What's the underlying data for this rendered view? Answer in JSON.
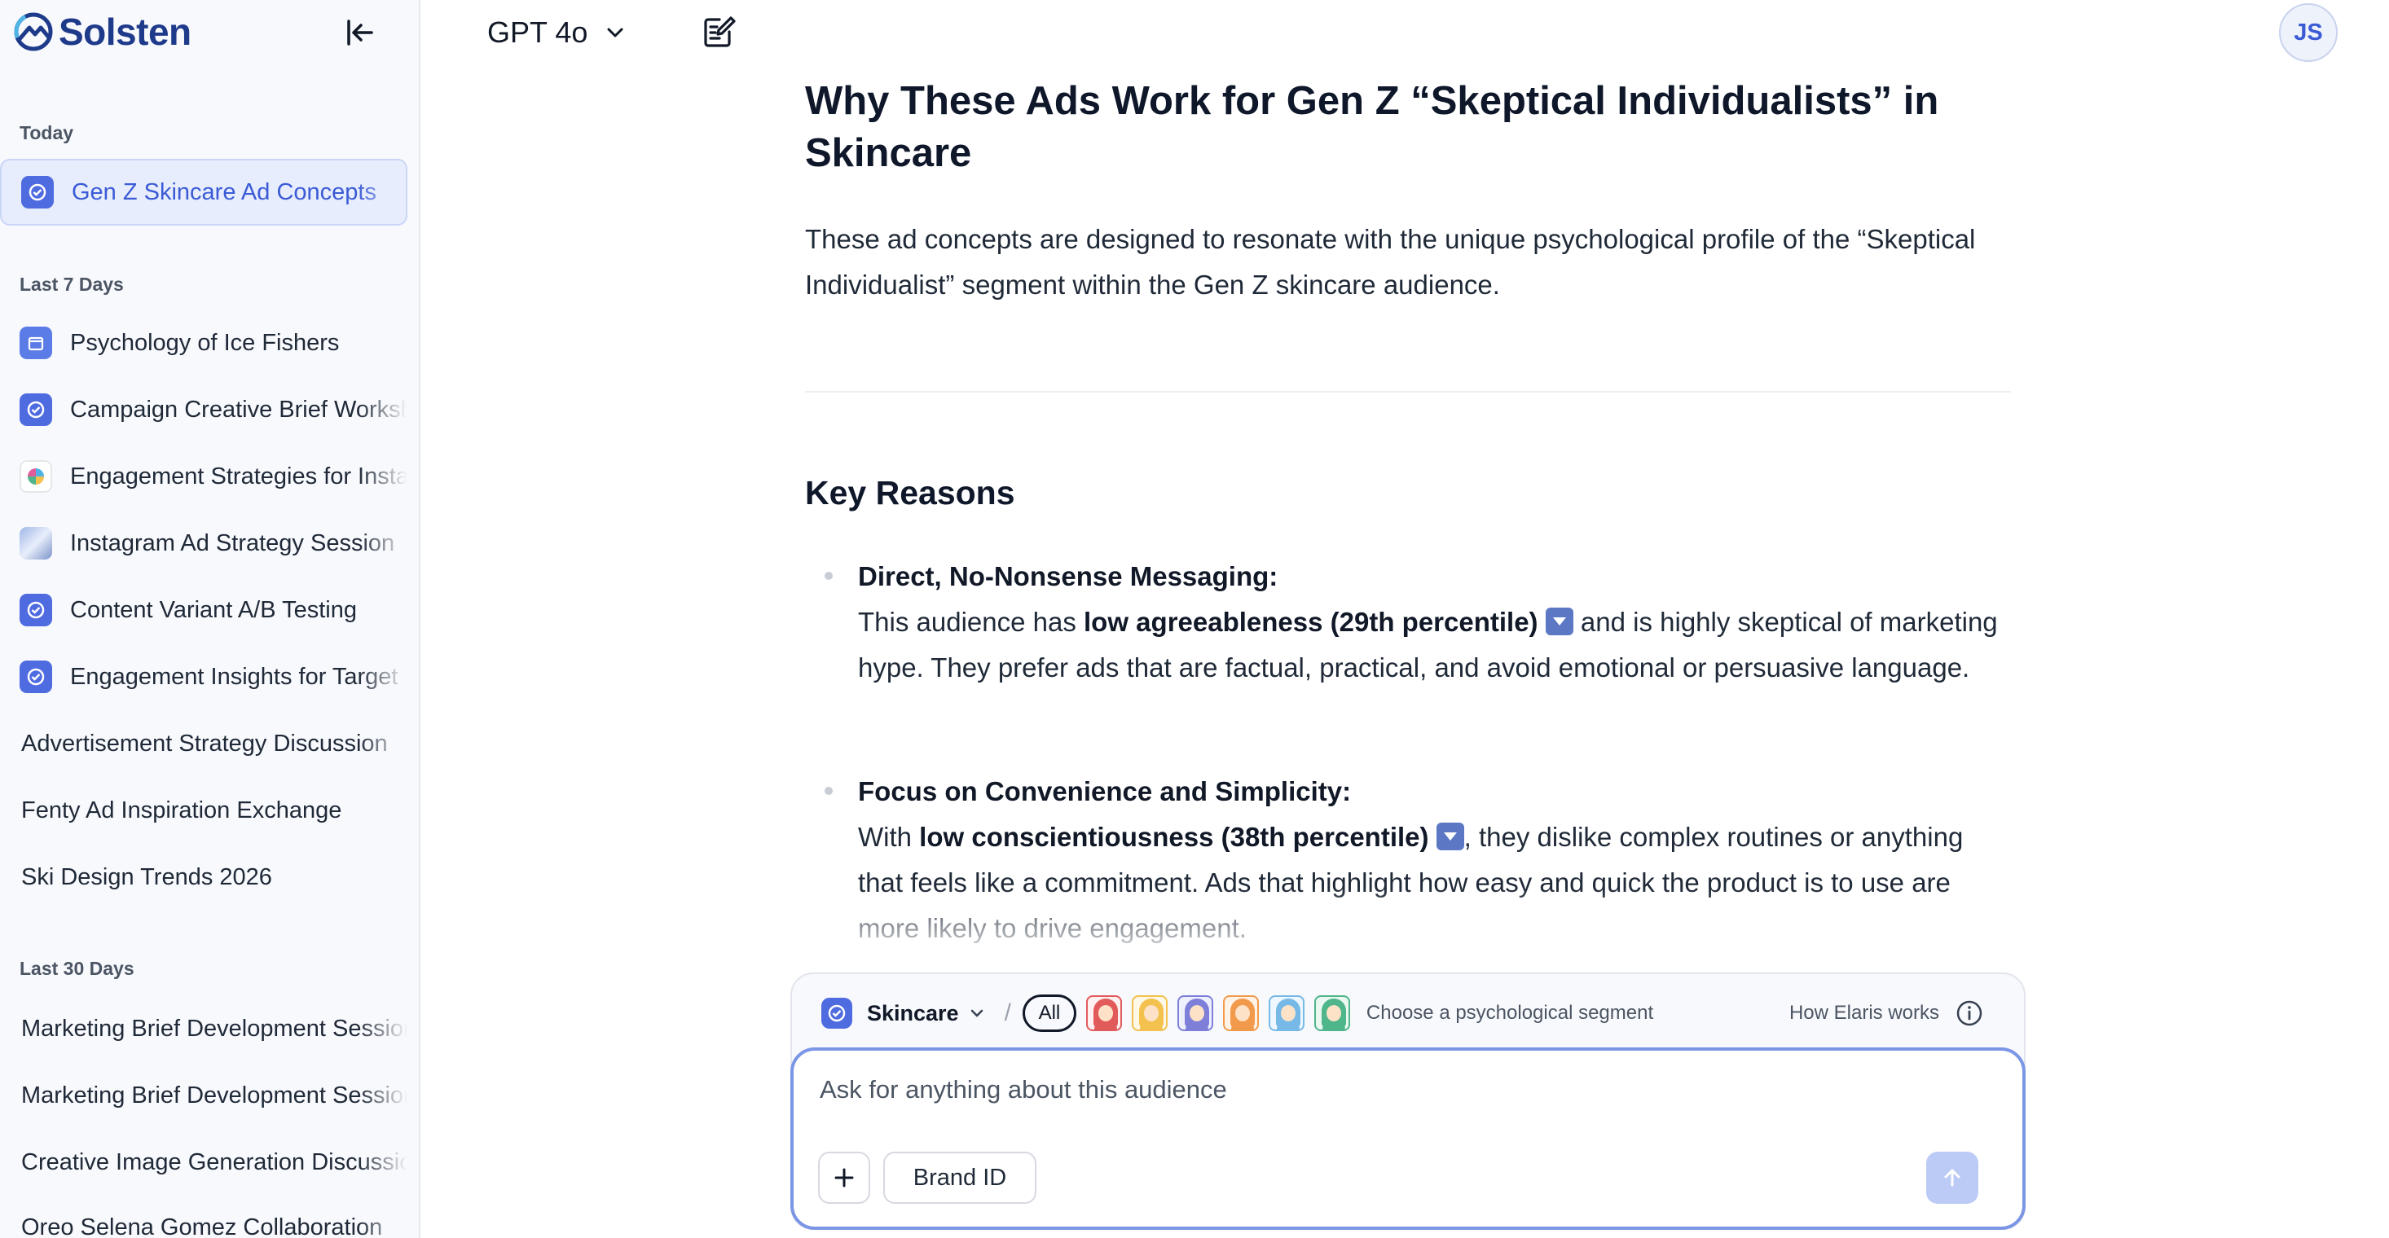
{
  "brand": {
    "name": "Solsten"
  },
  "sidebar": {
    "sections": {
      "today": "Today",
      "last7": "Last 7 Days",
      "last30": "Last 30 Days"
    },
    "today_items": [
      {
        "label": "Gen Z Skincare Ad Concepts",
        "icon": "badge-check-icon"
      }
    ],
    "last7_items": [
      {
        "label": "Psychology of Ice Fishers",
        "icon": "calendar-icon"
      },
      {
        "label": "Campaign Creative Brief Workshop",
        "icon": "badge-check-icon"
      },
      {
        "label": "Engagement Strategies for Instagram",
        "icon": "pinwheel-icon"
      },
      {
        "label": "Instagram Ad Strategy Session",
        "icon": "photo-thumbnail-icon"
      },
      {
        "label": "Content Variant A/B Testing",
        "icon": "badge-check-icon"
      },
      {
        "label": "Engagement Insights for Target",
        "icon": "badge-check-icon"
      },
      {
        "label": "Advertisement Strategy Discussion",
        "icon": ""
      },
      {
        "label": "Fenty Ad Inspiration Exchange",
        "icon": ""
      },
      {
        "label": "Ski Design Trends 2026",
        "icon": ""
      }
    ],
    "last30_items": [
      {
        "label": "Marketing Brief Development Session"
      },
      {
        "label": "Marketing Brief Development Session"
      },
      {
        "label": "Creative Image Generation Discussion"
      },
      {
        "label": "Oreo Selena Gomez Collaboration"
      }
    ]
  },
  "topbar": {
    "model": "GPT 4o",
    "avatar_initials": "JS"
  },
  "article": {
    "title": "Why These Ads Work for Gen Z “Skeptical Individualists” in Skincare",
    "intro": "These ad concepts are designed to resonate with the unique psychological profile of the “Skeptical Individualist” segment within the Gen Z skincare audience.",
    "section_heading": "Key Reasons",
    "reasons": [
      {
        "title": "Direct, No-Nonsense Messaging:",
        "lead": "This audience has ",
        "bold": "low agreeableness (29th percentile)",
        "rest": " and is highly skeptical of marketing hype. They prefer ads that are factual, practical, and avoid emotional or persuasive language."
      },
      {
        "title": "Focus on Convenience and Simplicity:",
        "lead": "With ",
        "bold": "low conscientiousness (38th percentile)",
        "rest": ", they dislike complex routines or anything that feels like a commitment. Ads that highlight how easy and quick the product is to use are more likely to drive engagement."
      }
    ]
  },
  "composer": {
    "segment_name": "Skincare",
    "slash": "/",
    "all_label": "All",
    "personas": [
      {
        "hair": "#e25b5b",
        "shirt": "#e25b5b",
        "bg": "#fff1f1"
      },
      {
        "hair": "#f2c14e",
        "shirt": "#f2c14e",
        "bg": "#fff8e6"
      },
      {
        "hair": "#7e7fd8",
        "shirt": "#7e7fd8",
        "bg": "#eef0ff"
      },
      {
        "hair": "#f29a4b",
        "shirt": "#f29a4b",
        "bg": "#fff3e8"
      },
      {
        "hair": "#76b9e6",
        "shirt": "#76b9e6",
        "bg": "#eef7ff"
      },
      {
        "hair": "#4fb58a",
        "shirt": "#4fb58a",
        "bg": "#eaf8f1"
      }
    ],
    "segment_hint": "Choose a psychological segment",
    "how_works": "How Elaris works",
    "placeholder": "Ask for anything about this audience",
    "brand_id_label": "Brand ID"
  },
  "colors": {
    "accent": "#3b5bd6",
    "brand": "#1e3a8a",
    "input_border": "#7c96e6",
    "send_button": "#bccbf6"
  }
}
